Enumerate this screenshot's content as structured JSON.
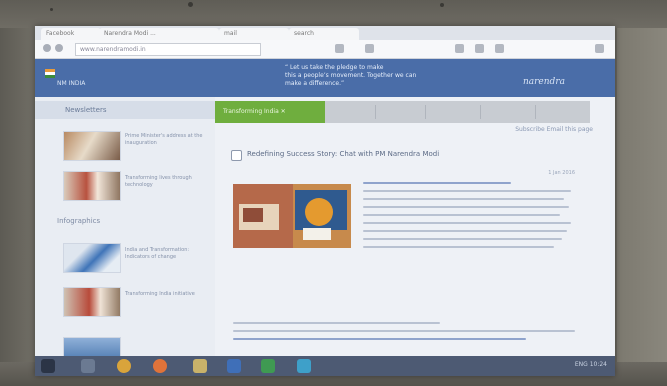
{
  "browser": {
    "tabs": [
      "Facebook",
      "Narendra Modi ...",
      "mail",
      "search"
    ],
    "url": "www.narendramodi.in"
  },
  "site": {
    "logo_text": "NM INDIA",
    "banner_lines": [
      "“ Let us take the pledge to make",
      "this a people’s movement. Together we can",
      "make a difference.”"
    ],
    "banner_signature": "narendra"
  },
  "sidebar": {
    "title": "Newsletters",
    "section2_title": "Infographics",
    "items": [
      {
        "text": "Prime Minister's address at the inauguration"
      },
      {
        "text": "Transforming lives through technology"
      },
      {
        "text": "India and Transformation: Indicators of change"
      },
      {
        "text": "Transforming India initiative"
      }
    ]
  },
  "content_tabs": {
    "active": "Transforming India ✕",
    "close": "✕"
  },
  "main": {
    "toolbar_links": "Subscribe    Email this page",
    "post_title": "Redefining Success Story: Chat with PM Narendra Modi",
    "post_date": "1 Jan 2016",
    "colors": {
      "header": "#4a6da8",
      "active_tab": "#6fae3e",
      "taskbar": "#4d5a73"
    }
  },
  "taskbar": {
    "icons": [
      "start-icon",
      "explorer-icon",
      "chrome-icon",
      "firefox-icon",
      "folder-icon",
      "word-icon",
      "excel-icon",
      "photos-icon"
    ],
    "tray_text": "ENG  10:24"
  }
}
